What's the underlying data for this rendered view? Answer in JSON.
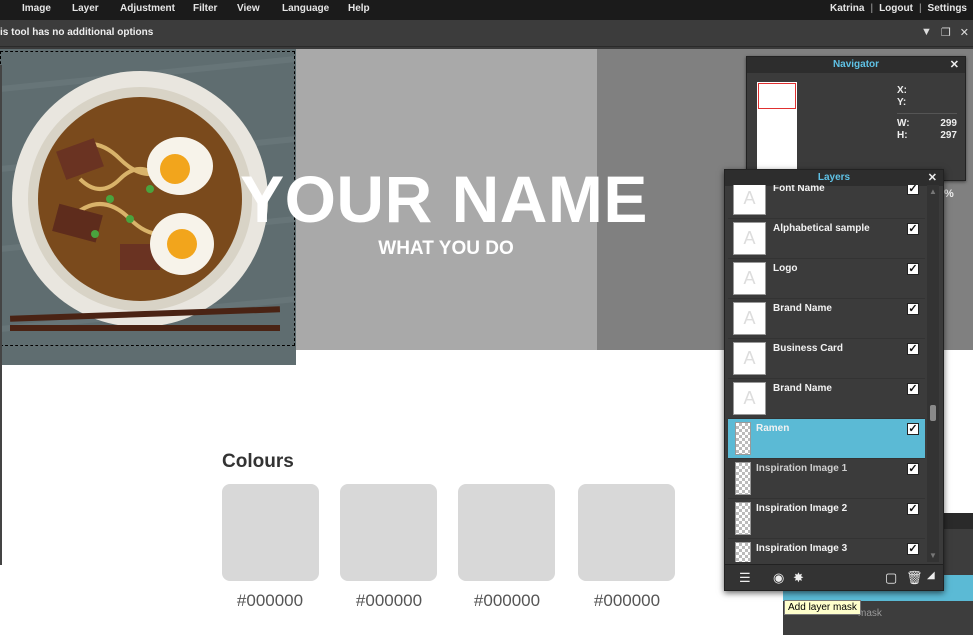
{
  "menu": {
    "items": [
      "Image",
      "Layer",
      "Adjustment",
      "Filter",
      "View",
      "Language",
      "Help"
    ],
    "user": "Katrina",
    "logout": "Logout",
    "settings": "Settings"
  },
  "options_bar": {
    "message": "is tool has no additional options"
  },
  "canvas": {
    "title": "YOUR NAME",
    "subtitle": "WHAT YOU DO",
    "colours_heading": "Colours",
    "swatches": [
      "#000000",
      "#000000",
      "#000000",
      "#000000"
    ]
  },
  "navigator": {
    "title": "Navigator",
    "x_label": "X:",
    "y_label": "Y:",
    "w_label": "W:",
    "w_value": "299",
    "h_label": "H:",
    "h_value": "297",
    "zoom_suffix": "%"
  },
  "layers": {
    "title": "Layers",
    "items": [
      {
        "name": "Font Name",
        "visible": true
      },
      {
        "name": "Alphabetical sample",
        "visible": true
      },
      {
        "name": "Logo",
        "visible": true
      },
      {
        "name": "Brand Name",
        "visible": true
      },
      {
        "name": "Business Card",
        "visible": true
      },
      {
        "name": "Brand Name",
        "visible": true
      },
      {
        "name": "Ramen",
        "visible": true,
        "selected": true
      },
      {
        "name": "Inspiration Image 1",
        "visible": true
      },
      {
        "name": "Inspiration Image 2",
        "visible": true
      },
      {
        "name": "Inspiration Image 3",
        "visible": true
      }
    ]
  },
  "history_ghost": "mask",
  "tooltip": "Add layer mask",
  "colors": {
    "accent": "#5bbad5",
    "panel_title": "#5fc2e6"
  }
}
